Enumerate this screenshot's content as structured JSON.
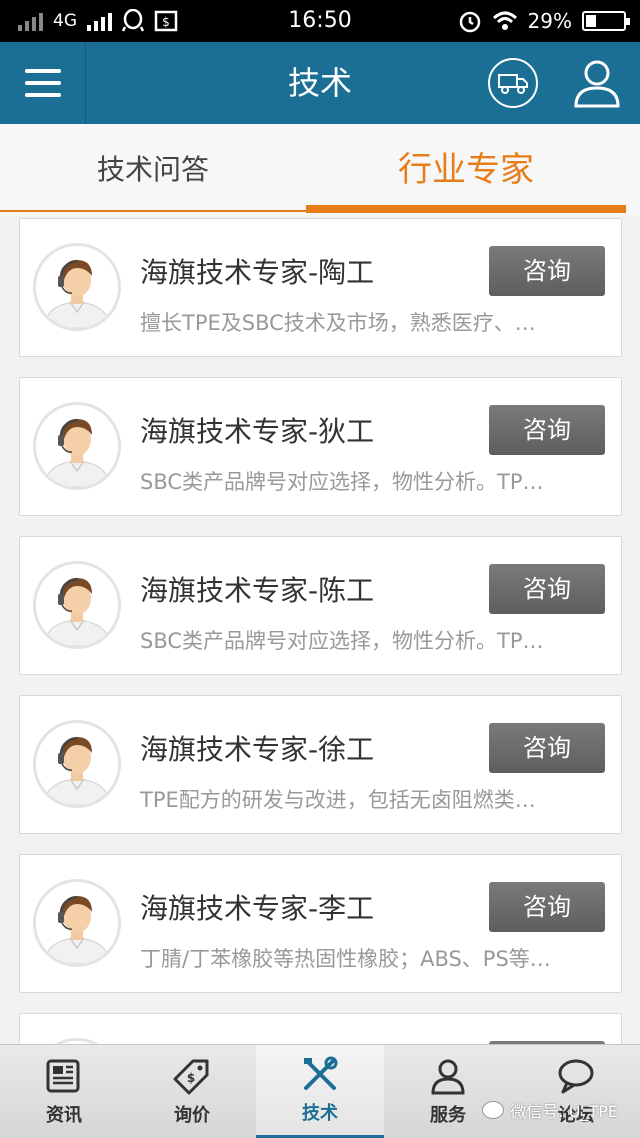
{
  "status_bar": {
    "network": "4G",
    "time": "16:50",
    "battery": "29%",
    "battery_level": 0.29
  },
  "header": {
    "title": "技术"
  },
  "tabs": [
    {
      "label": "技术问答",
      "active": false
    },
    {
      "label": "行业专家",
      "active": true
    }
  ],
  "experts": [
    {
      "name": "海旗技术专家-陶工",
      "desc": "擅长TPE及SBC技术及市场，熟悉医疗、…",
      "button": "咨询"
    },
    {
      "name": "海旗技术专家-狄工",
      "desc": "SBC类产品牌号对应选择，物性分析。TP…",
      "button": "咨询"
    },
    {
      "name": "海旗技术专家-陈工",
      "desc": "SBC类产品牌号对应选择，物性分析。TP…",
      "button": "咨询"
    },
    {
      "name": "海旗技术专家-徐工",
      "desc": "TPE配方的研发与改进，包括无卤阻燃类…",
      "button": "咨询"
    },
    {
      "name": "海旗技术专家-李工",
      "desc": "丁腈/丁苯橡胶等热固性橡胶；ABS、PS等…",
      "button": "咨询"
    }
  ],
  "bottom_nav": [
    {
      "label": "资讯",
      "icon": "newspaper-icon",
      "active": false
    },
    {
      "label": "询价",
      "icon": "price-tag-icon",
      "active": false
    },
    {
      "label": "技术",
      "icon": "tools-icon",
      "active": true
    },
    {
      "label": "服务",
      "icon": "person-icon",
      "active": false
    },
    {
      "label": "论坛",
      "icon": "chat-bubble-icon",
      "active": false
    }
  ],
  "watermark": "微信号: U_TPE",
  "colors": {
    "header": "#1b6e94",
    "accent": "#e77d18",
    "button": "#6b6b6b"
  }
}
